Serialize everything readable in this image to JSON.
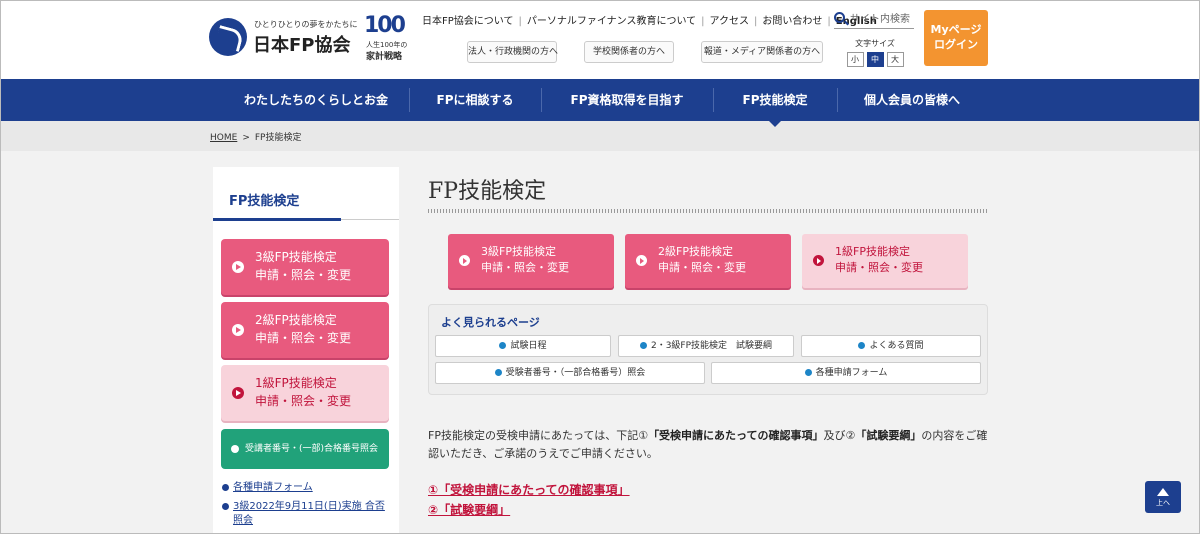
{
  "header": {
    "logo_tagline": "ひとりひとりの夢をかたちに",
    "logo_name": "日本FP協会",
    "badge_number": "100",
    "badge_line1": "人生100年の",
    "badge_line2": "家計戦略",
    "top_links": [
      "日本FP協会について",
      "パーソナルファイナンス教育について",
      "アクセス",
      "お問い合わせ",
      "English"
    ],
    "search_placeholder": "サイト内検索",
    "sub_links": [
      "法人・行政機関の方へ",
      "学校関係者の方へ",
      "報道・メディア関係者の方へ"
    ],
    "font_size_label": "文字サイズ",
    "font_sizes": [
      "小",
      "中",
      "大"
    ],
    "font_size_selected": "中",
    "mypage_line1": "Myページ",
    "mypage_line2": "ログイン"
  },
  "main_nav": [
    "わたしたちのくらしとお金",
    "FPに相談する",
    "FP資格取得を目指す",
    "FP技能検定",
    "個人会員の皆様へ"
  ],
  "main_nav_active": "FP技能検定",
  "breadcrumb": {
    "home": "HOME",
    "separator": ">",
    "current": "FP技能検定"
  },
  "sidebar": {
    "title": "FP技能検定",
    "buttons": [
      {
        "line1": "3級FP技能検定",
        "line2": "申請・照会・変更"
      },
      {
        "line1": "2級FP技能検定",
        "line2": "申請・照会・変更"
      },
      {
        "line1": "1級FP技能検定",
        "line2": "申請・照会・変更"
      }
    ],
    "green_button": "受講者番号・(一部)合格番号照会",
    "links": [
      "各種申請フォーム",
      "3級2022年9月11日(日)実施 合否照会"
    ]
  },
  "main": {
    "title": "FP技能検定",
    "cards": [
      {
        "line1": "3級FP技能検定",
        "line2": "申請・照会・変更"
      },
      {
        "line1": "2級FP技能検定",
        "line2": "申請・照会・変更"
      },
      {
        "line1": "1級FP技能検定",
        "line2": "申請・照会・変更"
      }
    ],
    "popular_heading": "よく見られるページ",
    "popular_links": [
      "試験日程",
      "2・3級FP技能検定　試験要綱",
      "よくある質問",
      "受験者番号・（一部合格番号）照会",
      "各種申請フォーム"
    ],
    "desc_part1": "FP技能検定の受検申請にあたっては、下記①",
    "desc_bold1": "「受検申請にあたっての確認事項」",
    "desc_part2": "及び②",
    "desc_bold2": "「試験要綱」",
    "desc_part3": "の内容をご確認いただき、ご承諾のうえでご申請ください。",
    "link1": "①「受検申請にあたっての確認事項」",
    "link2": "②「試験要綱」"
  },
  "to_top_label": "上へ",
  "colors": {
    "brand_blue": "#1d3f8f",
    "pink": "#e85a7e",
    "light_pink": "#f8d3db",
    "green": "#21a27a",
    "orange": "#f39430"
  }
}
